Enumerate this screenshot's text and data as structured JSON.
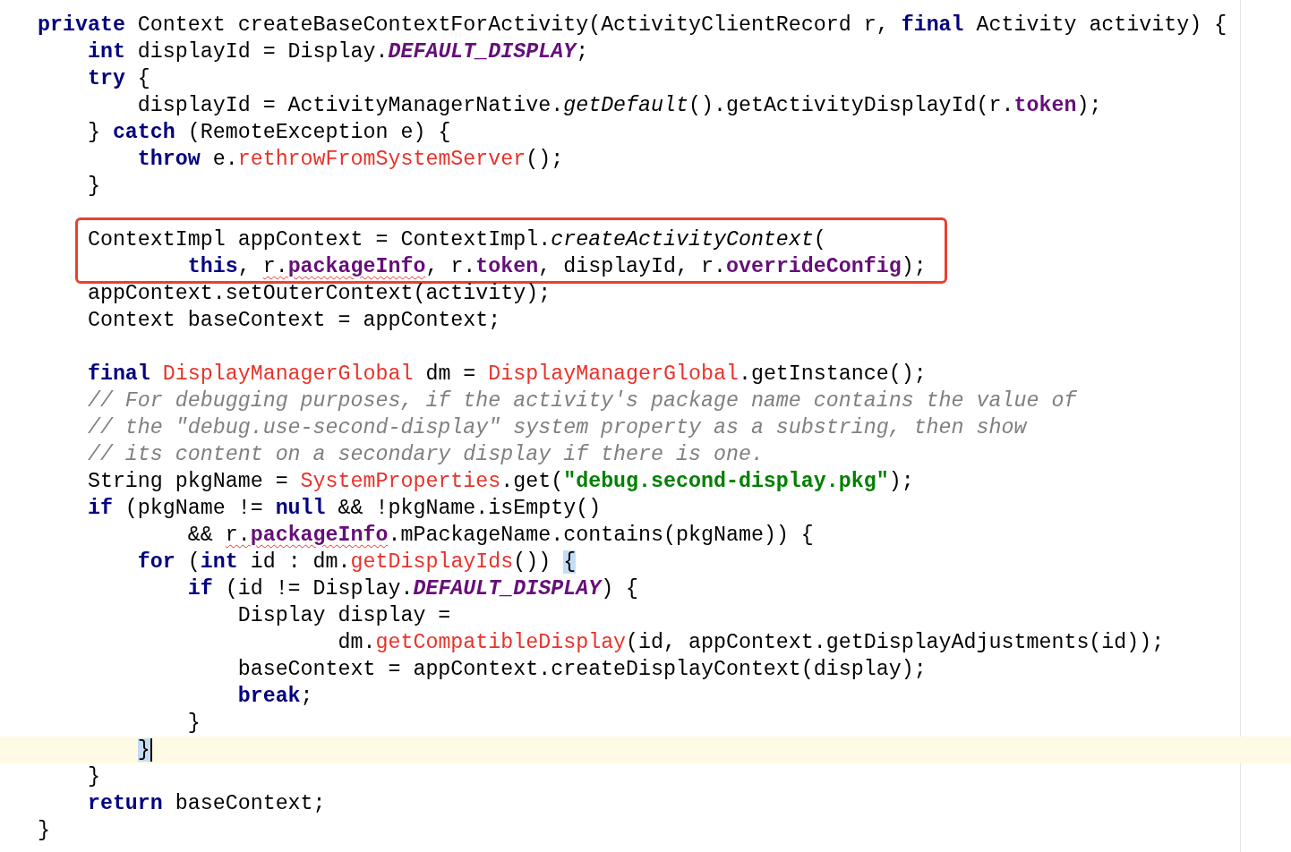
{
  "blocks": [
    {
      "highlight_box": false,
      "space_before": false,
      "lines": [
        {
          "current": false,
          "tokens": [
            {
              "kind": "kw",
              "t": "private"
            },
            {
              "kind": "plain",
              "t": " Context createBaseContextForActivity(ActivityClientRecord r, "
            },
            {
              "kind": "kw",
              "t": "final"
            },
            {
              "kind": "plain",
              "t": " Activity activity) {"
            }
          ]
        },
        {
          "current": false,
          "tokens": [
            {
              "kind": "kw",
              "t": "    int"
            },
            {
              "kind": "plain",
              "t": " displayId = Display."
            },
            {
              "kind": "static",
              "t": "DEFAULT_DISPLAY"
            },
            {
              "kind": "plain",
              "t": ";"
            }
          ]
        },
        {
          "current": false,
          "tokens": [
            {
              "kind": "kw",
              "t": "    try"
            },
            {
              "kind": "plain",
              "t": " {"
            }
          ]
        },
        {
          "current": false,
          "tokens": [
            {
              "kind": "plain",
              "t": "        displayId = ActivityManagerNative."
            },
            {
              "kind": "italic",
              "t": "getDefault"
            },
            {
              "kind": "plain",
              "t": "().getActivityDisplayId(r."
            },
            {
              "kind": "field",
              "t": "token"
            },
            {
              "kind": "plain",
              "t": ");"
            }
          ]
        },
        {
          "current": false,
          "tokens": [
            {
              "kind": "plain",
              "t": "    } "
            },
            {
              "kind": "kw",
              "t": "catch"
            },
            {
              "kind": "plain",
              "t": " (RemoteException e) {"
            }
          ]
        },
        {
          "current": false,
          "tokens": [
            {
              "kind": "kw",
              "t": "        throw"
            },
            {
              "kind": "plain",
              "t": " e."
            },
            {
              "kind": "unresolved",
              "t": "rethrowFromSystemServer"
            },
            {
              "kind": "plain",
              "t": "();"
            }
          ]
        },
        {
          "current": false,
          "tokens": [
            {
              "kind": "plain",
              "t": "    }"
            }
          ]
        }
      ]
    },
    {
      "highlight_box": true,
      "space_before": true,
      "lines": [
        {
          "current": false,
          "tokens": [
            {
              "kind": "plain",
              "t": "    ContextImpl appContext = ContextImpl."
            },
            {
              "kind": "italic",
              "t": "createActivityContext"
            },
            {
              "kind": "plain",
              "t": "("
            }
          ]
        },
        {
          "current": false,
          "tokens": [
            {
              "kind": "kw",
              "t": "            this"
            },
            {
              "kind": "plain",
              "t": ", "
            },
            {
              "kind": "plain-warn",
              "t": "r."
            },
            {
              "kind": "field-warn",
              "t": "packageInfo"
            },
            {
              "kind": "plain",
              "t": ", r."
            },
            {
              "kind": "field",
              "t": "token"
            },
            {
              "kind": "plain",
              "t": ", displayId, r."
            },
            {
              "kind": "field",
              "t": "overrideConfig"
            },
            {
              "kind": "plain",
              "t": ");"
            }
          ]
        }
      ]
    },
    {
      "highlight_box": false,
      "space_before": false,
      "lines": [
        {
          "current": false,
          "tokens": [
            {
              "kind": "plain",
              "t": "    appContext.setOuterContext(activity);"
            }
          ]
        },
        {
          "current": false,
          "tokens": [
            {
              "kind": "plain",
              "t": "    Context baseContext = appContext;"
            }
          ]
        }
      ]
    },
    {
      "highlight_box": false,
      "space_before": true,
      "lines": [
        {
          "current": false,
          "tokens": [
            {
              "kind": "kw",
              "t": "    final"
            },
            {
              "kind": "unresolved",
              "t": " DisplayManagerGlobal"
            },
            {
              "kind": "plain",
              "t": " dm = "
            },
            {
              "kind": "unresolved",
              "t": "DisplayManagerGlobal"
            },
            {
              "kind": "plain",
              "t": ".getInstance();"
            }
          ]
        },
        {
          "current": false,
          "tokens": [
            {
              "kind": "comment",
              "t": "    // For debugging purposes, if the activity's package name contains the value of"
            }
          ]
        },
        {
          "current": false,
          "tokens": [
            {
              "kind": "comment",
              "t": "    // the \"debug.use-second-display\" system property as a substring, then show"
            }
          ]
        },
        {
          "current": false,
          "tokens": [
            {
              "kind": "comment",
              "t": "    // its content on a secondary display if there is one."
            }
          ]
        },
        {
          "current": false,
          "tokens": [
            {
              "kind": "plain",
              "t": "    String pkgName = "
            },
            {
              "kind": "unresolved",
              "t": "SystemProperties"
            },
            {
              "kind": "plain",
              "t": ".get("
            },
            {
              "kind": "string",
              "t": "\"debug.second-display.pkg\""
            },
            {
              "kind": "plain",
              "t": ");"
            }
          ]
        },
        {
          "current": false,
          "tokens": [
            {
              "kind": "kw",
              "t": "    if"
            },
            {
              "kind": "plain",
              "t": " (pkgName != "
            },
            {
              "kind": "kw",
              "t": "null"
            },
            {
              "kind": "plain",
              "t": " && !pkgName.isEmpty()"
            }
          ]
        },
        {
          "current": false,
          "tokens": [
            {
              "kind": "plain",
              "t": "            && "
            },
            {
              "kind": "plain-warn",
              "t": "r."
            },
            {
              "kind": "field-warn",
              "t": "packageInfo"
            },
            {
              "kind": "plain",
              "t": ".mPackageName.contains(pkgName)) {"
            }
          ]
        },
        {
          "current": false,
          "tokens": [
            {
              "kind": "kw",
              "t": "        for"
            },
            {
              "kind": "plain",
              "t": " ("
            },
            {
              "kind": "kw",
              "t": "int"
            },
            {
              "kind": "plain",
              "t": " id : dm."
            },
            {
              "kind": "unresolved",
              "t": "getDisplayIds"
            },
            {
              "kind": "plain",
              "t": "()) "
            },
            {
              "kind": "brace-match",
              "t": "{"
            }
          ]
        },
        {
          "current": false,
          "tokens": [
            {
              "kind": "kw",
              "t": "            if"
            },
            {
              "kind": "plain",
              "t": " (id != Display."
            },
            {
              "kind": "static",
              "t": "DEFAULT_DISPLAY"
            },
            {
              "kind": "plain",
              "t": ") {"
            }
          ]
        },
        {
          "current": false,
          "tokens": [
            {
              "kind": "plain",
              "t": "                Display display ="
            }
          ]
        },
        {
          "current": false,
          "tokens": [
            {
              "kind": "plain",
              "t": "                        dm."
            },
            {
              "kind": "unresolved",
              "t": "getCompatibleDisplay"
            },
            {
              "kind": "plain",
              "t": "(id, appContext.getDisplayAdjustments(id));"
            }
          ]
        },
        {
          "current": false,
          "tokens": [
            {
              "kind": "plain",
              "t": "                baseContext = appContext.createDisplayContext(display);"
            }
          ]
        },
        {
          "current": false,
          "tokens": [
            {
              "kind": "kw",
              "t": "                break"
            },
            {
              "kind": "plain",
              "t": ";"
            }
          ]
        },
        {
          "current": false,
          "tokens": [
            {
              "kind": "plain",
              "t": "            }"
            }
          ]
        },
        {
          "current": true,
          "tokens": [
            {
              "kind": "brace-match",
              "t": "        }"
            }
          ]
        },
        {
          "current": false,
          "tokens": [
            {
              "kind": "plain",
              "t": "    }"
            }
          ]
        },
        {
          "current": false,
          "tokens": [
            {
              "kind": "kw",
              "t": "    return"
            },
            {
              "kind": "plain",
              "t": " baseContext;"
            }
          ]
        },
        {
          "current": false,
          "tokens": [
            {
              "kind": "plain",
              "t": "}"
            }
          ]
        }
      ]
    }
  ]
}
